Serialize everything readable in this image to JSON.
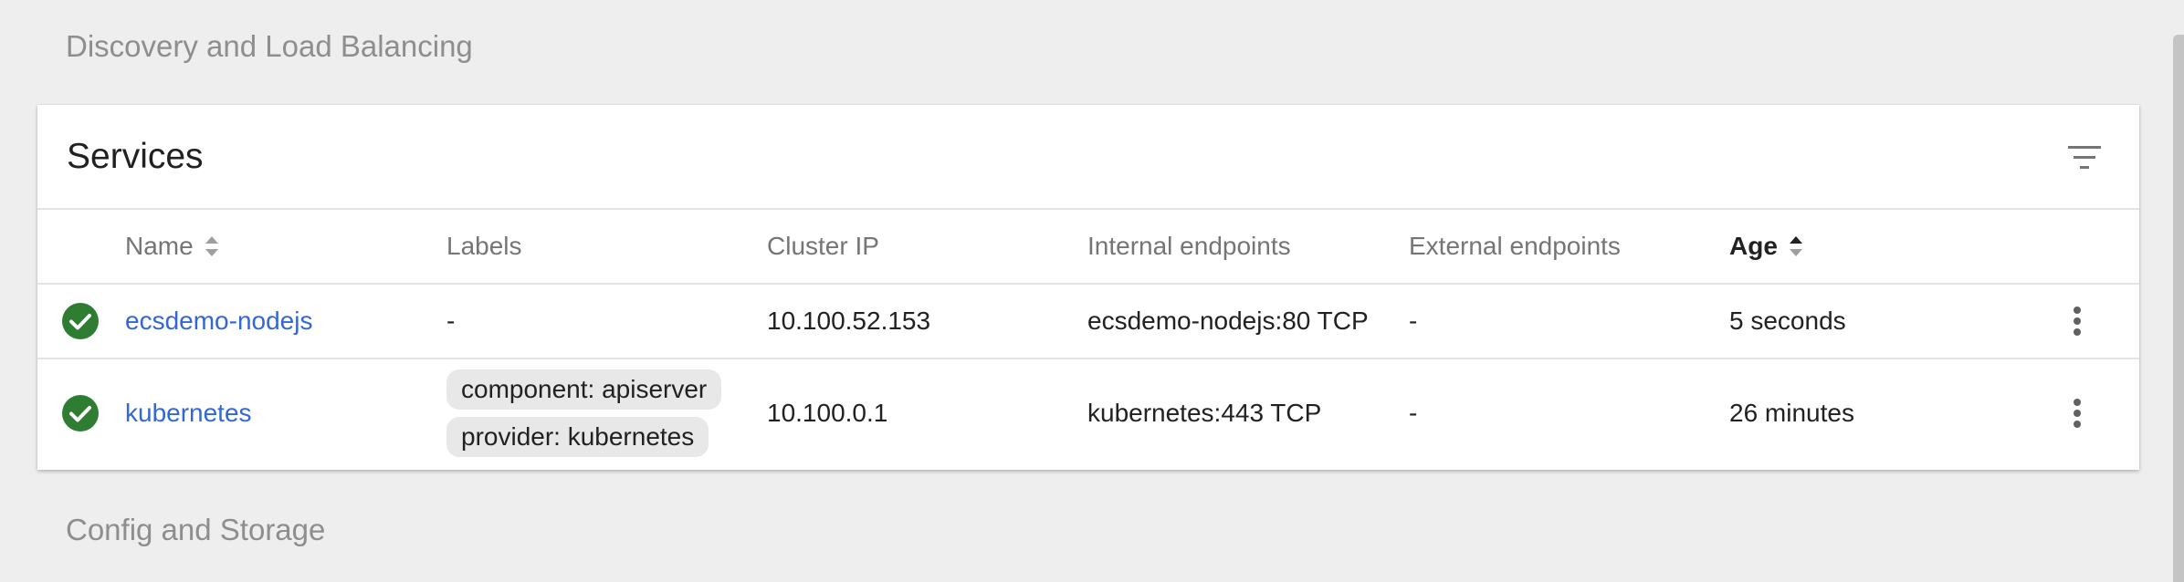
{
  "sections": {
    "discovery": "Discovery and Load Balancing",
    "config": "Config and Storage"
  },
  "card": {
    "title": "Services"
  },
  "table": {
    "headers": {
      "name": "Name",
      "labels": "Labels",
      "cluster_ip": "Cluster IP",
      "internal": "Internal endpoints",
      "external": "External endpoints",
      "age": "Age"
    },
    "rows": [
      {
        "status": "ok",
        "name": "ecsdemo-nodejs",
        "labels_text": "-",
        "cluster_ip": "10.100.52.153",
        "internal": "ecsdemo-nodejs:80 TCP",
        "external": "-",
        "age": "5 seconds"
      },
      {
        "status": "ok",
        "name": "kubernetes",
        "labels": [
          "component: apiserver",
          "provider: kubernetes"
        ],
        "cluster_ip": "10.100.0.1",
        "internal": "kubernetes:443 TCP",
        "external": "-",
        "age": "26 minutes"
      }
    ]
  },
  "icons": {
    "status": "check-circle-icon",
    "filter": "filter-icon",
    "sort": "sort-icon",
    "menu": "more-vert-icon"
  },
  "colors": {
    "success": "#2e7d32",
    "link": "#3367d6"
  }
}
